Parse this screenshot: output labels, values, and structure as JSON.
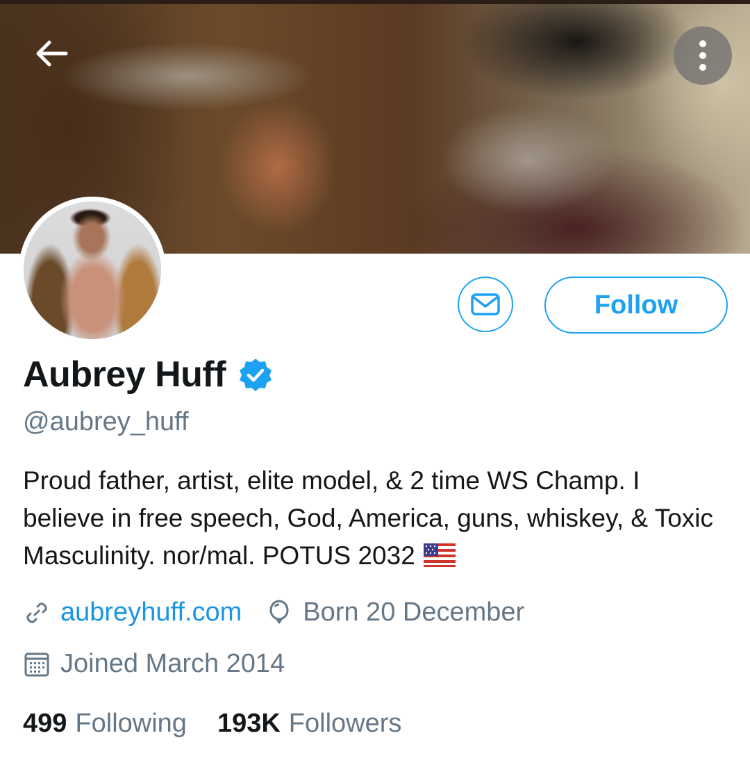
{
  "header": {
    "back_icon": "arrow-left-icon",
    "more_icon": "more-vertical-icon"
  },
  "profile": {
    "name": "Aubrey Huff",
    "handle": "@aubrey_huff",
    "verified": true,
    "bio": "Proud father, artist, elite model, & 2 time WS Champ. I believe in free speech, God, America, guns, whiskey, & Toxic Masculinity. nor/mal. POTUS 2032",
    "bio_emoji": "us-flag-emoji",
    "website": "aubreyhuff.com",
    "birthday": "Born 20 December",
    "joined": "Joined March 2014"
  },
  "actions": {
    "message_icon": "envelope-icon",
    "follow_label": "Follow"
  },
  "stats": {
    "following_count": "499",
    "following_label": "Following",
    "followers_count": "193K",
    "followers_label": "Followers"
  },
  "colors": {
    "accent": "#1da1f2",
    "link": "#1b95e0",
    "text_primary": "#14171a",
    "text_secondary": "#657786"
  }
}
